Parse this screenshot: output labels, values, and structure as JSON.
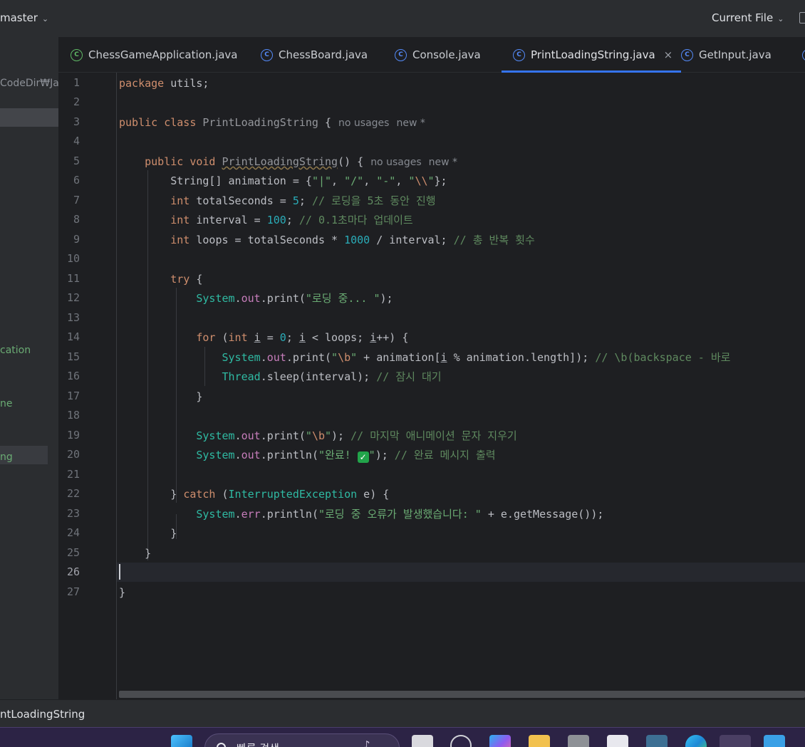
{
  "topbar": {
    "branch": "master",
    "run_config": "Current File",
    "branch_icon": "chevron-down-icon",
    "run_icon": "chevron-down-icon"
  },
  "tabs": [
    {
      "label": "ChessGameApplication.java",
      "icon": "class-icon",
      "color": "#5fb865",
      "active": false
    },
    {
      "label": "ChessBoard.java",
      "icon": "class-icon",
      "color": "#548af7",
      "active": false
    },
    {
      "label": "Console.java",
      "icon": "class-icon",
      "color": "#548af7",
      "active": false
    },
    {
      "label": "PrintLoadingString.java",
      "icon": "class-icon",
      "color": "#548af7",
      "active": true,
      "close": "×"
    },
    {
      "label": "GetInput.java",
      "icon": "class-icon",
      "color": "#548af7",
      "active": false
    }
  ],
  "project_panel": {
    "path": "CodeDir₩Ja",
    "items": [
      "cation",
      "ne",
      "ng"
    ]
  },
  "editor": {
    "line_numbers": [
      "1",
      "2",
      "3",
      "4",
      "5",
      "6",
      "7",
      "8",
      "9",
      "10",
      "11",
      "12",
      "13",
      "14",
      "15",
      "16",
      "17",
      "18",
      "19",
      "20",
      "21",
      "22",
      "23",
      "24",
      "25",
      "26",
      "27"
    ],
    "current_line": "26",
    "hints": {
      "class_usages": "no usages",
      "class_new": "new *",
      "method_usages": "no usages",
      "method_new": "new *"
    },
    "tokens": {
      "l1_kw": "package",
      "l1_rest": " utils;",
      "l3_kw1": "public",
      "l3_kw2": "class",
      "l3_name": "PrintLoadingString",
      "l3_rest": " {",
      "l5_kw1": "public",
      "l5_kw2": "void",
      "l5_name": "PrintLoadingString",
      "l5_rest": "() {",
      "l6_a": "String[] animation = {",
      "l6_s1": "\"|\"",
      "l6_c1": ", ",
      "l6_s2": "\"/\"",
      "l6_c2": ", ",
      "l6_s3": "\"-\"",
      "l6_c3": ", ",
      "l6_s4a": "\"",
      "l6_s4esc": "\\\\",
      "l6_s4b": "\"",
      "l6_end": "};",
      "l7_kw": "int",
      "l7_a": " totalSeconds = ",
      "l7_num": "5",
      "l7_b": "; ",
      "l7_cmt": "// 로딩을 5초 동안 진행",
      "l8_kw": "int",
      "l8_a": " interval = ",
      "l8_num": "100",
      "l8_b": "; ",
      "l8_cmt": "// 0.1초마다 업데이트",
      "l9_kw": "int",
      "l9_a": " loops = totalSeconds * ",
      "l9_num": "1000",
      "l9_b": " / interval; ",
      "l9_cmt": "// 총 반복 횟수",
      "l11_kw": "try",
      "l11_rest": " {",
      "l12_sys": "System",
      "l12_dot1": ".",
      "l12_out": "out",
      "l12_dot2": ".",
      "l12_m": "print",
      "l12_p1": "(",
      "l12_str": "\"로딩 중... \"",
      "l12_end": ");",
      "l14_kw": "for",
      "l14_a": " (",
      "l14_kw2": "int",
      "l14_i1": "i",
      "l14_b": " = ",
      "l14_num": "0",
      "l14_c": "; ",
      "l14_i2": "i",
      "l14_d": " < loops; ",
      "l14_i3": "i",
      "l14_e": "++) {",
      "l15_sys": "System",
      "l15_dot1": ".",
      "l15_out": "out",
      "l15_dot2": ".",
      "l15_m": "print",
      "l15_p1": "(",
      "l15_s1": "\"",
      "l15_esc": "\\b",
      "l15_s2": "\"",
      "l15_a": " + animation[",
      "l15_i": "i",
      "l15_b": " % animation.length]); ",
      "l15_cmt": "// \\b(backspace - 바로",
      "l16_cls": "Thread",
      "l16_dot": ".",
      "l16_m": "sleep",
      "l16_a": "(interval); ",
      "l16_cmt": "// 잠시 대기",
      "l17": "}",
      "l19_sys": "System",
      "l19_dot1": ".",
      "l19_out": "out",
      "l19_dot2": ".",
      "l19_m": "print",
      "l19_p1": "(",
      "l19_s1": "\"",
      "l19_esc": "\\b",
      "l19_s2": "\"",
      "l19_a": "); ",
      "l19_cmt": "// 마지막 애니메이션 문자 지우기",
      "l20_sys": "System",
      "l20_dot1": ".",
      "l20_out": "out",
      "l20_dot2": ".",
      "l20_m": "println",
      "l20_p1": "(",
      "l20_s1": "\"완료! ",
      "l20_check": "✓",
      "l20_s2": "\"",
      "l20_a": "); ",
      "l20_cmt": "// 완료 메시지 출력",
      "l22_a": "} ",
      "l22_kw": "catch",
      "l22_b": " (",
      "l22_ty": "InterruptedException",
      "l22_c": " e) {",
      "l23_sys": "System",
      "l23_dot1": ".",
      "l23_err": "err",
      "l23_dot2": ".",
      "l23_m": "println",
      "l23_p1": "(",
      "l23_str": "\"로딩 중 오류가 발생했습니다: \"",
      "l23_a": " + e.",
      "l23_m2": "getMessage",
      "l23_end": "());",
      "l24": "}",
      "l25": "}",
      "l27": "}"
    }
  },
  "statusbar": {
    "breadcrumb": "ntLoadingString"
  },
  "taskbar": {
    "search_placeholder": "빠른 검색",
    "icons": [
      "windows-start-icon",
      "search-icon",
      "file-icon",
      "settings-icon",
      "copilot-icon",
      "folder-icon",
      "camera-icon",
      "store-icon",
      "mysql-icon",
      "edge-icon",
      "java-icon",
      "calendar-icon"
    ]
  }
}
